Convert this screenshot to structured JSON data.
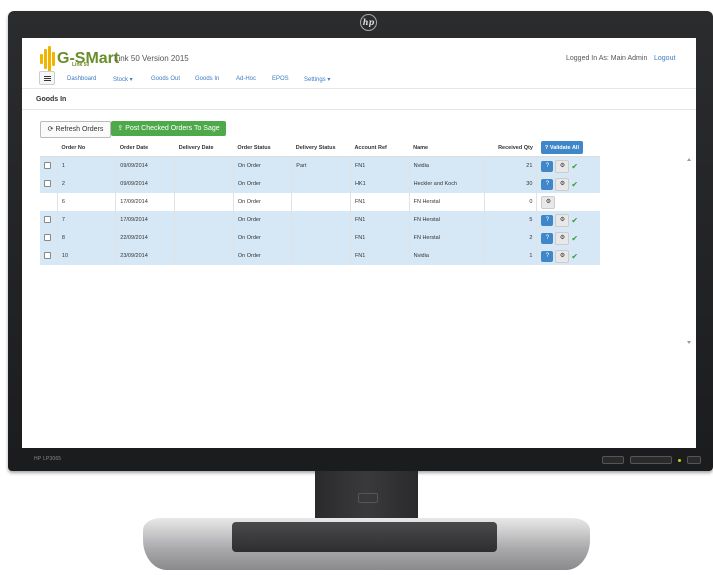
{
  "app": {
    "brand": "G-SMart",
    "brand_sub": "Link 50",
    "version": "Link 50 Version 2015",
    "logged_in": "Logged In As: Main Admin",
    "logout": "Logout"
  },
  "nav": {
    "items": [
      "Dashboard",
      "Stock ▾",
      "Goods Out",
      "Goods In",
      "Ad-Hoc",
      "EPOS",
      "Settings ▾"
    ]
  },
  "page": {
    "title": "Goods In",
    "refresh_label": "Refresh Orders",
    "post_label": "Post Checked Orders To Sage",
    "validate_all_label": "Validate All"
  },
  "table": {
    "headers": [
      "Order No",
      "Order Date",
      "Delivery Date",
      "Order Status",
      "Delivery Status",
      "Account Ref",
      "Name",
      "Received Qty"
    ],
    "rows": [
      {
        "order_no": "1",
        "order_date": "09/09/2014",
        "delivery_date": "",
        "status": "On Order",
        "delivery_status": "Part",
        "account": "FN1",
        "name": "Nvidia",
        "qty": "21"
      },
      {
        "order_no": "2",
        "order_date": "09/09/2014",
        "delivery_date": "",
        "status": "On Order",
        "delivery_status": "",
        "account": "HK1",
        "name": "Heckler and Koch",
        "qty": "30"
      },
      {
        "order_no": "6",
        "order_date": "17/09/2014",
        "delivery_date": "",
        "status": "On Order",
        "delivery_status": "",
        "account": "FN1",
        "name": "FN Herstal",
        "qty": "0"
      },
      {
        "order_no": "7",
        "order_date": "17/09/2014",
        "delivery_date": "",
        "status": "On Order",
        "delivery_status": "",
        "account": "FN1",
        "name": "FN Herstal",
        "qty": "5"
      },
      {
        "order_no": "8",
        "order_date": "22/09/2014",
        "delivery_date": "",
        "status": "On Order",
        "delivery_status": "",
        "account": "FN1",
        "name": "FN Herstal",
        "qty": "2"
      },
      {
        "order_no": "10",
        "order_date": "23/09/2014",
        "delivery_date": "",
        "status": "On Order",
        "delivery_status": "",
        "account": "FN1",
        "name": "Nvidia",
        "qty": "1"
      }
    ]
  },
  "monitor": {
    "model": "HP LP3065"
  },
  "colors": {
    "accent": "#3c7ac2",
    "button_green": "#4ea94b",
    "row_highlight": "#d6e7f5",
    "brand_green": "#6a8e2b",
    "brand_gold": "#f2b400"
  }
}
